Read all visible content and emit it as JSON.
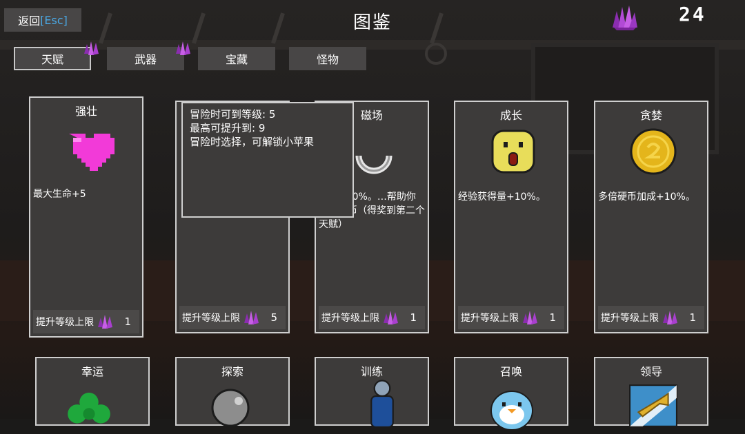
{
  "header": {
    "back_label": "返回",
    "back_key": "[Esc]",
    "title": "图鉴",
    "gem_count": "24",
    "gem_icon": "purple-crystal-icon"
  },
  "tabs": [
    {
      "label": "天赋",
      "active": true,
      "has_gem": true
    },
    {
      "label": "武器",
      "active": false,
      "has_gem": true
    },
    {
      "label": "宝藏",
      "active": false,
      "has_gem": false
    },
    {
      "label": "怪物",
      "active": false,
      "has_gem": false
    }
  ],
  "cards": [
    {
      "name": "强壮",
      "icon": "pink-heart-icon",
      "desc": "最大生命+5",
      "upgrade_label": "提升等级上限",
      "level": "1"
    },
    {
      "name": "",
      "icon": "",
      "desc": "",
      "upgrade_label": "提升等级上限",
      "level": "5"
    },
    {
      "name": "磁场",
      "icon": "magnet-icon",
      "desc": "…围+20%。…帮助你拾取硬币（得奖到第二个天赋）",
      "upgrade_label": "提升等级上限",
      "level": "1"
    },
    {
      "name": "成长",
      "icon": "yellow-face-icon",
      "desc": "经验获得量+10%。",
      "upgrade_label": "提升等级上限",
      "level": "1"
    },
    {
      "name": "贪婪",
      "icon": "gold-coin-icon",
      "desc": "多倍硬币加成+10%。",
      "upgrade_label": "提升等级上限",
      "level": "1"
    },
    {
      "name": "幸运",
      "icon": "clover-icon"
    },
    {
      "name": "探索",
      "icon": "magnifier-icon"
    },
    {
      "name": "训练",
      "icon": "blue-figure-icon"
    },
    {
      "name": "召唤",
      "icon": "penguin-icon"
    },
    {
      "name": "领导",
      "icon": "trumpet-icon"
    }
  ],
  "tooltip": {
    "lines": [
      "冒险时可到等级: 5",
      "最高可提升到: 9",
      "冒险时选择，可解锁小苹果"
    ]
  },
  "colors": {
    "accent_blue": "#4aa9e6",
    "gem_purple": "#a93fcf",
    "heart_pink": "#f23ad8",
    "card_bg": "#3d3b3a"
  }
}
